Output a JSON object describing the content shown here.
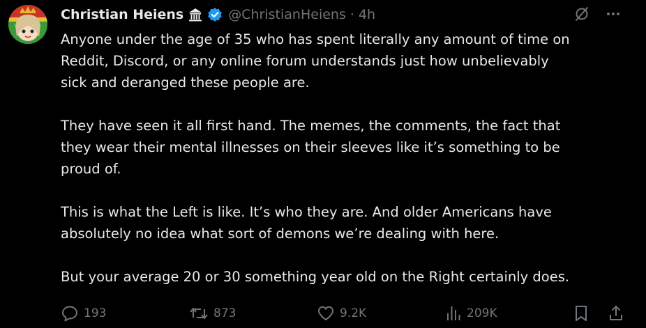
{
  "tweet": {
    "author": {
      "display_name": "Christian Heiens",
      "handle": "@ChristianHeiens",
      "badge_icon": "classical-building-icon",
      "verified_icon": "verified-badge-icon",
      "verified_color": "#1d9bf0"
    },
    "separator": "·",
    "timestamp": "4h",
    "body": [
      "Anyone under the age of 35 who has spent literally any amount of time on\nReddit, Discord, or any online forum understands just how unbelievably\nsick and deranged these people are.",
      "They have seen it all first hand. The memes, the comments, the fact that\nthey wear their mental illnesses on their sleeves like it’s something to be\nproud of.",
      "This is what the Left is like. It’s who they are. And older Americans have\nabsolutely no idea what sort of demons we’re dealing with here.",
      "But your average 20 or 30 something year old on the Right certainly does."
    ],
    "stats": {
      "replies": "193",
      "reposts": "873",
      "likes": "9.2K",
      "views": "209K"
    }
  },
  "colors": {
    "background": "#000000",
    "text": "#e7e9ea",
    "muted": "#71767b"
  }
}
